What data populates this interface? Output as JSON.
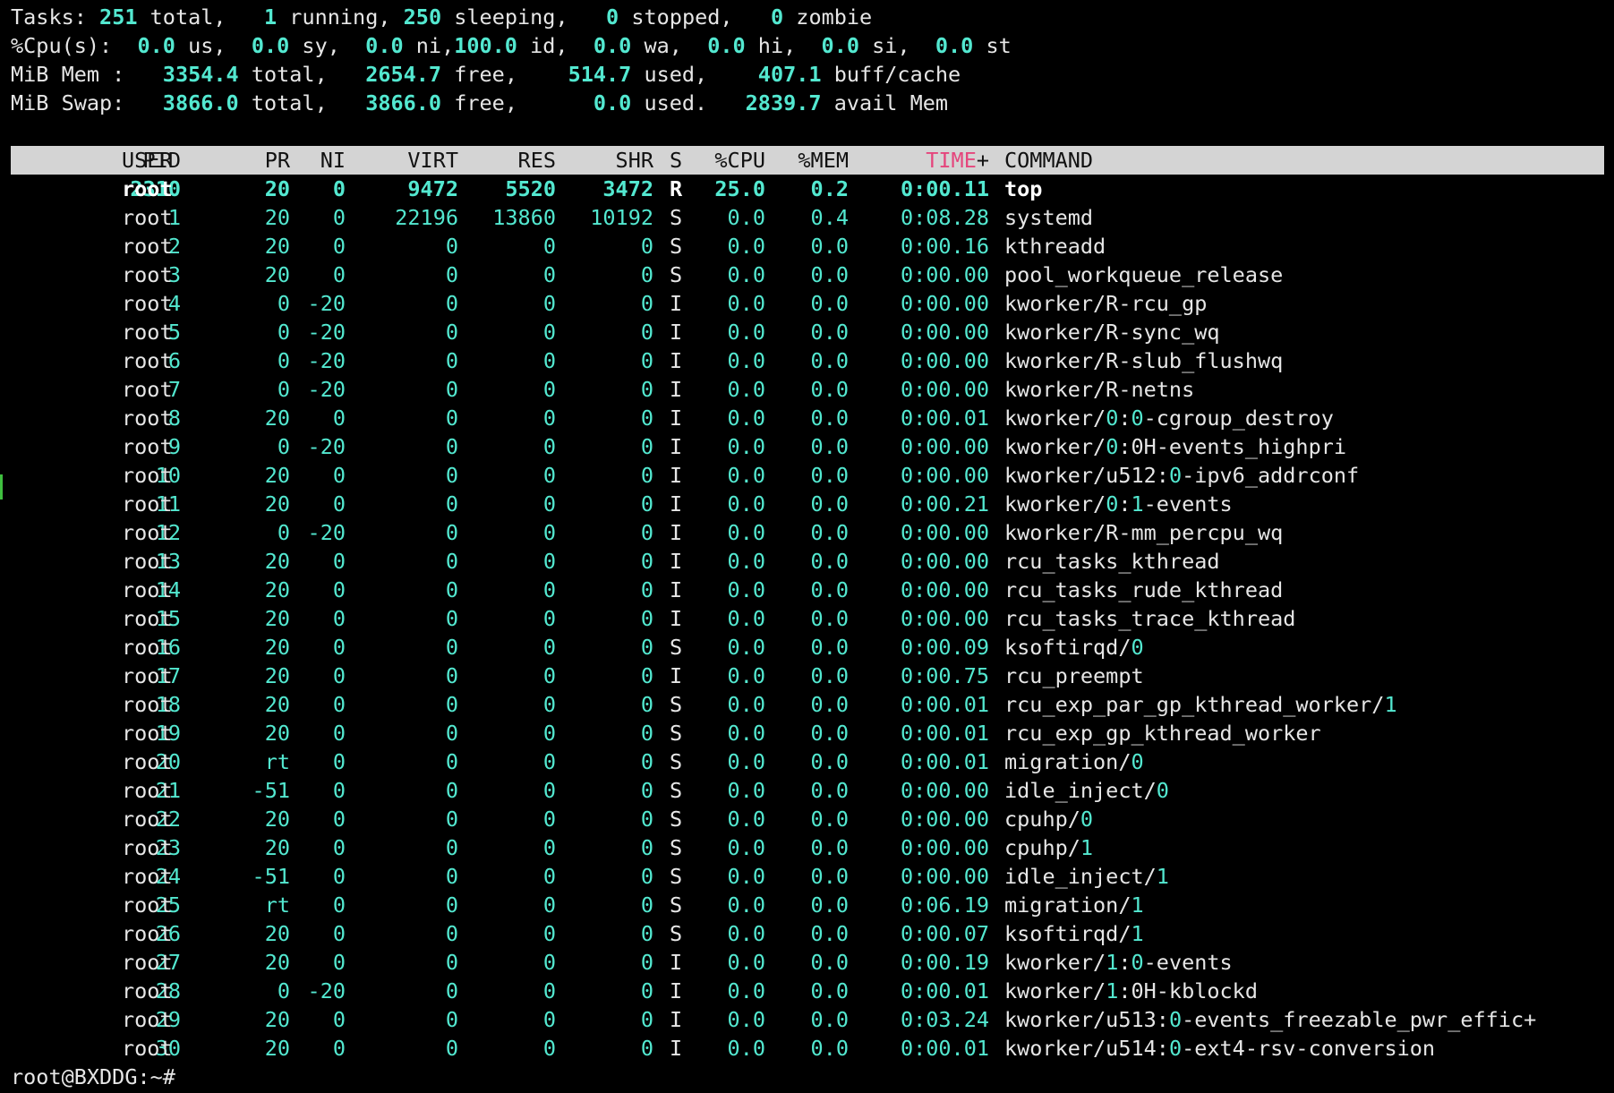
{
  "summary": {
    "tasks": {
      "label": "Tasks:",
      "total": "251",
      "total_l": " total,",
      "running": "1",
      "running_l": " running,",
      "sleeping": "250",
      "sleeping_l": " sleeping,",
      "stopped": "0",
      "stopped_l": " stopped,",
      "zombie": "0",
      "zombie_l": " zombie"
    },
    "cpu": {
      "label": "%Cpu(s):",
      "us": "0.0",
      "us_l": " us,",
      "sy": "0.0",
      "sy_l": " sy,",
      "ni": "0.0",
      "ni_l": " ni,",
      "id": "100.0",
      "id_l": " id,",
      "wa": "0.0",
      "wa_l": " wa,",
      "hi": "0.0",
      "hi_l": " hi,",
      "si": "0.0",
      "si_l": " si,",
      "st": "0.0",
      "st_l": " st"
    },
    "mem": {
      "label": "MiB Mem :",
      "total": "3354.4",
      "total_l": " total,",
      "free": "2654.7",
      "free_l": " free,",
      "used": "514.7",
      "used_l": " used,",
      "buff": "407.1",
      "buff_l": " buff/cache"
    },
    "swap": {
      "label": "MiB Swap:",
      "total": "3866.0",
      "total_l": " total,",
      "free": "3866.0",
      "free_l": " free,",
      "used": "0.0",
      "used_l": " used.",
      "avail": "2839.7",
      "avail_l": " avail Mem"
    }
  },
  "columns": {
    "pid": "PID",
    "user": "USER",
    "pr": "PR",
    "ni": "NI",
    "virt": "VIRT",
    "res": "RES",
    "shr": "SHR",
    "s": "S",
    "cpu": "%CPU",
    "mem": "%MEM",
    "time": "TIME",
    "time_plus": "+",
    "cmd": "COMMAND"
  },
  "processes": [
    {
      "pid": "2310",
      "user": "root",
      "pr": "20",
      "ni": "0",
      "virt": "9472",
      "res": "5520",
      "shr": "3472",
      "s": "R",
      "cpu": "25.0",
      "mem": "0.2",
      "time": "0:00.11",
      "cmd": [
        "top"
      ]
    },
    {
      "pid": "1",
      "user": "root",
      "pr": "20",
      "ni": "0",
      "virt": "22196",
      "res": "13860",
      "shr": "10192",
      "s": "S",
      "cpu": "0.0",
      "mem": "0.4",
      "time": "0:08.28",
      "cmd": [
        "systemd"
      ]
    },
    {
      "pid": "2",
      "user": "root",
      "pr": "20",
      "ni": "0",
      "virt": "0",
      "res": "0",
      "shr": "0",
      "s": "S",
      "cpu": "0.0",
      "mem": "0.0",
      "time": "0:00.16",
      "cmd": [
        "kthreadd"
      ]
    },
    {
      "pid": "3",
      "user": "root",
      "pr": "20",
      "ni": "0",
      "virt": "0",
      "res": "0",
      "shr": "0",
      "s": "S",
      "cpu": "0.0",
      "mem": "0.0",
      "time": "0:00.00",
      "cmd": [
        "pool_workqueue_release"
      ]
    },
    {
      "pid": "4",
      "user": "root",
      "pr": "0",
      "ni": "-20",
      "virt": "0",
      "res": "0",
      "shr": "0",
      "s": "I",
      "cpu": "0.0",
      "mem": "0.0",
      "time": "0:00.00",
      "cmd": [
        "kworker/R-rcu_gp"
      ]
    },
    {
      "pid": "5",
      "user": "root",
      "pr": "0",
      "ni": "-20",
      "virt": "0",
      "res": "0",
      "shr": "0",
      "s": "I",
      "cpu": "0.0",
      "mem": "0.0",
      "time": "0:00.00",
      "cmd": [
        "kworker/R-sync_wq"
      ]
    },
    {
      "pid": "6",
      "user": "root",
      "pr": "0",
      "ni": "-20",
      "virt": "0",
      "res": "0",
      "shr": "0",
      "s": "I",
      "cpu": "0.0",
      "mem": "0.0",
      "time": "0:00.00",
      "cmd": [
        "kworker/R-slub_flushwq"
      ]
    },
    {
      "pid": "7",
      "user": "root",
      "pr": "0",
      "ni": "-20",
      "virt": "0",
      "res": "0",
      "shr": "0",
      "s": "I",
      "cpu": "0.0",
      "mem": "0.0",
      "time": "0:00.00",
      "cmd": [
        "kworker/R-netns"
      ]
    },
    {
      "pid": "8",
      "user": "root",
      "pr": "20",
      "ni": "0",
      "virt": "0",
      "res": "0",
      "shr": "0",
      "s": "I",
      "cpu": "0.0",
      "mem": "0.0",
      "time": "0:00.01",
      "cmd": [
        "kworker/",
        "0",
        ":",
        "0",
        "-cgroup_destroy"
      ]
    },
    {
      "pid": "9",
      "user": "root",
      "pr": "0",
      "ni": "-20",
      "virt": "0",
      "res": "0",
      "shr": "0",
      "s": "I",
      "cpu": "0.0",
      "mem": "0.0",
      "time": "0:00.00",
      "cmd": [
        "kworker/",
        "0",
        ":0H-events_highpri"
      ]
    },
    {
      "pid": "10",
      "user": "root",
      "pr": "20",
      "ni": "0",
      "virt": "0",
      "res": "0",
      "shr": "0",
      "s": "I",
      "cpu": "0.0",
      "mem": "0.0",
      "time": "0:00.00",
      "cmd": [
        "kworker/u512:",
        "0",
        "-ipv6_addrconf"
      ]
    },
    {
      "pid": "11",
      "user": "root",
      "pr": "20",
      "ni": "0",
      "virt": "0",
      "res": "0",
      "shr": "0",
      "s": "I",
      "cpu": "0.0",
      "mem": "0.0",
      "time": "0:00.21",
      "cmd": [
        "kworker/",
        "0",
        ":",
        "1",
        "-events"
      ]
    },
    {
      "pid": "12",
      "user": "root",
      "pr": "0",
      "ni": "-20",
      "virt": "0",
      "res": "0",
      "shr": "0",
      "s": "I",
      "cpu": "0.0",
      "mem": "0.0",
      "time": "0:00.00",
      "cmd": [
        "kworker/R-mm_percpu_wq"
      ]
    },
    {
      "pid": "13",
      "user": "root",
      "pr": "20",
      "ni": "0",
      "virt": "0",
      "res": "0",
      "shr": "0",
      "s": "I",
      "cpu": "0.0",
      "mem": "0.0",
      "time": "0:00.00",
      "cmd": [
        "rcu_tasks_kthread"
      ]
    },
    {
      "pid": "14",
      "user": "root",
      "pr": "20",
      "ni": "0",
      "virt": "0",
      "res": "0",
      "shr": "0",
      "s": "I",
      "cpu": "0.0",
      "mem": "0.0",
      "time": "0:00.00",
      "cmd": [
        "rcu_tasks_rude_kthread"
      ]
    },
    {
      "pid": "15",
      "user": "root",
      "pr": "20",
      "ni": "0",
      "virt": "0",
      "res": "0",
      "shr": "0",
      "s": "I",
      "cpu": "0.0",
      "mem": "0.0",
      "time": "0:00.00",
      "cmd": [
        "rcu_tasks_trace_kthread"
      ]
    },
    {
      "pid": "16",
      "user": "root",
      "pr": "20",
      "ni": "0",
      "virt": "0",
      "res": "0",
      "shr": "0",
      "s": "S",
      "cpu": "0.0",
      "mem": "0.0",
      "time": "0:00.09",
      "cmd": [
        "ksoftirqd/",
        "0"
      ]
    },
    {
      "pid": "17",
      "user": "root",
      "pr": "20",
      "ni": "0",
      "virt": "0",
      "res": "0",
      "shr": "0",
      "s": "I",
      "cpu": "0.0",
      "mem": "0.0",
      "time": "0:00.75",
      "cmd": [
        "rcu_preempt"
      ]
    },
    {
      "pid": "18",
      "user": "root",
      "pr": "20",
      "ni": "0",
      "virt": "0",
      "res": "0",
      "shr": "0",
      "s": "S",
      "cpu": "0.0",
      "mem": "0.0",
      "time": "0:00.01",
      "cmd": [
        "rcu_exp_par_gp_kthread_worker/",
        "1"
      ]
    },
    {
      "pid": "19",
      "user": "root",
      "pr": "20",
      "ni": "0",
      "virt": "0",
      "res": "0",
      "shr": "0",
      "s": "S",
      "cpu": "0.0",
      "mem": "0.0",
      "time": "0:00.01",
      "cmd": [
        "rcu_exp_gp_kthread_worker"
      ]
    },
    {
      "pid": "20",
      "user": "root",
      "pr": "rt",
      "ni": "0",
      "virt": "0",
      "res": "0",
      "shr": "0",
      "s": "S",
      "cpu": "0.0",
      "mem": "0.0",
      "time": "0:00.01",
      "cmd": [
        "migration/",
        "0"
      ]
    },
    {
      "pid": "21",
      "user": "root",
      "pr": "-51",
      "ni": "0",
      "virt": "0",
      "res": "0",
      "shr": "0",
      "s": "S",
      "cpu": "0.0",
      "mem": "0.0",
      "time": "0:00.00",
      "cmd": [
        "idle_inject/",
        "0"
      ]
    },
    {
      "pid": "22",
      "user": "root",
      "pr": "20",
      "ni": "0",
      "virt": "0",
      "res": "0",
      "shr": "0",
      "s": "S",
      "cpu": "0.0",
      "mem": "0.0",
      "time": "0:00.00",
      "cmd": [
        "cpuhp/",
        "0"
      ]
    },
    {
      "pid": "23",
      "user": "root",
      "pr": "20",
      "ni": "0",
      "virt": "0",
      "res": "0",
      "shr": "0",
      "s": "S",
      "cpu": "0.0",
      "mem": "0.0",
      "time": "0:00.00",
      "cmd": [
        "cpuhp/",
        "1"
      ]
    },
    {
      "pid": "24",
      "user": "root",
      "pr": "-51",
      "ni": "0",
      "virt": "0",
      "res": "0",
      "shr": "0",
      "s": "S",
      "cpu": "0.0",
      "mem": "0.0",
      "time": "0:00.00",
      "cmd": [
        "idle_inject/",
        "1"
      ]
    },
    {
      "pid": "25",
      "user": "root",
      "pr": "rt",
      "ni": "0",
      "virt": "0",
      "res": "0",
      "shr": "0",
      "s": "S",
      "cpu": "0.0",
      "mem": "0.0",
      "time": "0:06.19",
      "cmd": [
        "migration/",
        "1"
      ]
    },
    {
      "pid": "26",
      "user": "root",
      "pr": "20",
      "ni": "0",
      "virt": "0",
      "res": "0",
      "shr": "0",
      "s": "S",
      "cpu": "0.0",
      "mem": "0.0",
      "time": "0:00.07",
      "cmd": [
        "ksoftirqd/",
        "1"
      ]
    },
    {
      "pid": "27",
      "user": "root",
      "pr": "20",
      "ni": "0",
      "virt": "0",
      "res": "0",
      "shr": "0",
      "s": "I",
      "cpu": "0.0",
      "mem": "0.0",
      "time": "0:00.19",
      "cmd": [
        "kworker/",
        "1",
        ":",
        "0",
        "-events"
      ]
    },
    {
      "pid": "28",
      "user": "root",
      "pr": "0",
      "ni": "-20",
      "virt": "0",
      "res": "0",
      "shr": "0",
      "s": "I",
      "cpu": "0.0",
      "mem": "0.0",
      "time": "0:00.01",
      "cmd": [
        "kworker/",
        "1",
        ":0H-kblockd"
      ]
    },
    {
      "pid": "29",
      "user": "root",
      "pr": "20",
      "ni": "0",
      "virt": "0",
      "res": "0",
      "shr": "0",
      "s": "I",
      "cpu": "0.0",
      "mem": "0.0",
      "time": "0:03.24",
      "cmd": [
        "kworker/u513:",
        "0",
        "-events_freezable_pwr_effic+"
      ]
    },
    {
      "pid": "30",
      "user": "root",
      "pr": "20",
      "ni": "0",
      "virt": "0",
      "res": "0",
      "shr": "0",
      "s": "I",
      "cpu": "0.0",
      "mem": "0.0",
      "time": "0:00.01",
      "cmd": [
        "kworker/u514:",
        "0",
        "-ext4-rsv-conversion"
      ]
    }
  ],
  "prompt": "root@BXDDG:~#",
  "colors": {
    "background": "#000000",
    "number": "#53e8d0",
    "header_bg": "#d4d4d4",
    "time_header": "#e5457c"
  }
}
